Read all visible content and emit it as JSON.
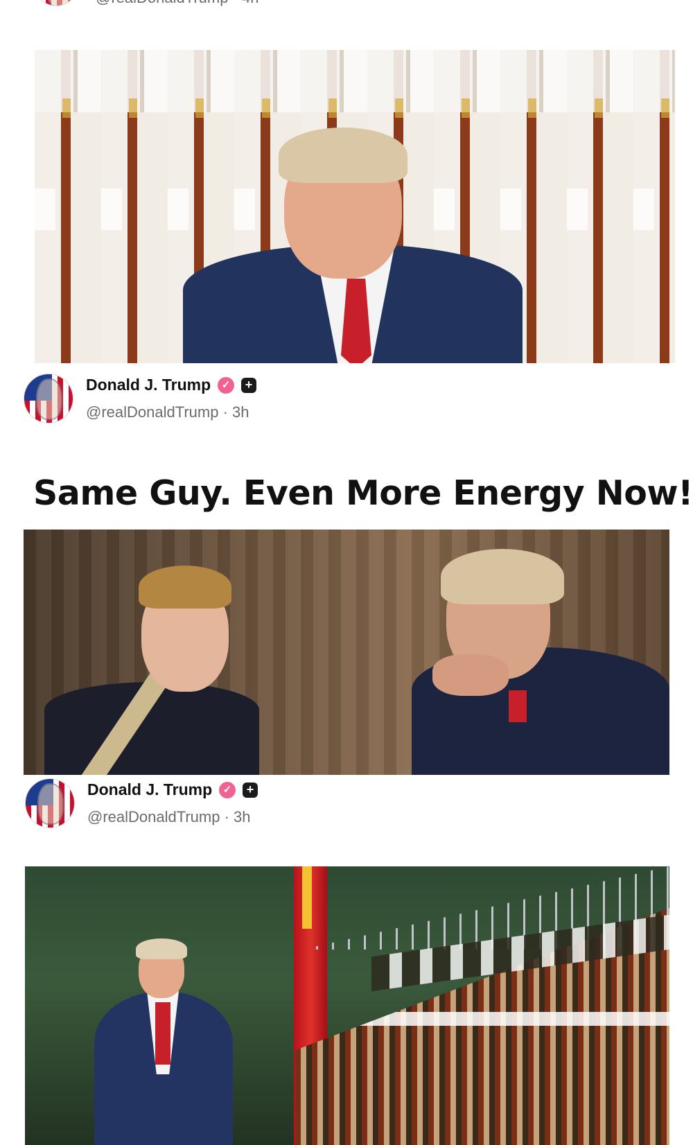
{
  "top_partial": {
    "handle_line": "@realDonaldTrump · 4h"
  },
  "posts": [
    {
      "author": "Donald J. Trump",
      "handle_line": "@realDonaldTrump · 3h",
      "caption": "Same Guy. Even More Energy Now!"
    },
    {
      "author": "Donald J. Trump",
      "handle_line": "@realDonaldTrump · 3h"
    }
  ],
  "icons": {
    "verified": "verified-badge-icon",
    "plus": "plus-badge-icon"
  },
  "colors": {
    "verified_badge": "#f06292",
    "plus_badge": "#1b1b1b",
    "handle_text": "#6b6b6b"
  }
}
